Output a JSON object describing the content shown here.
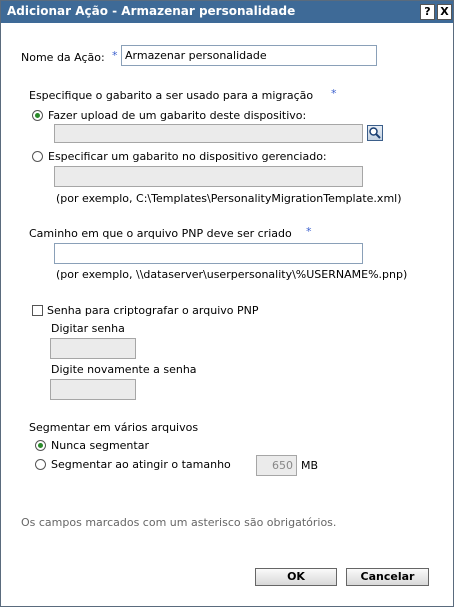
{
  "dialog": {
    "title": "Adicionar Ação - Armazenar personalidade",
    "help_label": "?",
    "close_label": "X"
  },
  "name": {
    "label": "Nome da Ação:",
    "value": "Armazenar personalidade"
  },
  "template": {
    "heading": "Especifique o gabarito a ser usado para a migração",
    "upload_label": "Fazer upload de um gabarito deste dispositivo:",
    "upload_value": "",
    "managed_label": "Especificar um gabarito no dispositivo gerenciado:",
    "managed_value": "",
    "managed_example": "(por exemplo, C:\\Templates\\PersonalityMigrationTemplate.xml)"
  },
  "path": {
    "label": "Caminho em que o arquivo PNP deve ser criado",
    "value": "",
    "example": "(por exemplo, \\\\dataserver\\userpersonality\\%USERNAME%.pnp)"
  },
  "password": {
    "checkbox_label": "Senha para criptografar o arquivo PNP",
    "enter_label": "Digitar senha",
    "reenter_label": "Digite novamente a senha"
  },
  "segment": {
    "heading": "Segmentar em vários arquivos",
    "never_label": "Nunca segmentar",
    "size_label": "Segmentar ao atingir o tamanho",
    "size_value": "650",
    "unit": "MB"
  },
  "footer": {
    "required_note": "Os campos marcados com um asterisco são obrigatórios.",
    "ok_label": "OK",
    "cancel_label": "Cancelar"
  },
  "required_marker": "*"
}
